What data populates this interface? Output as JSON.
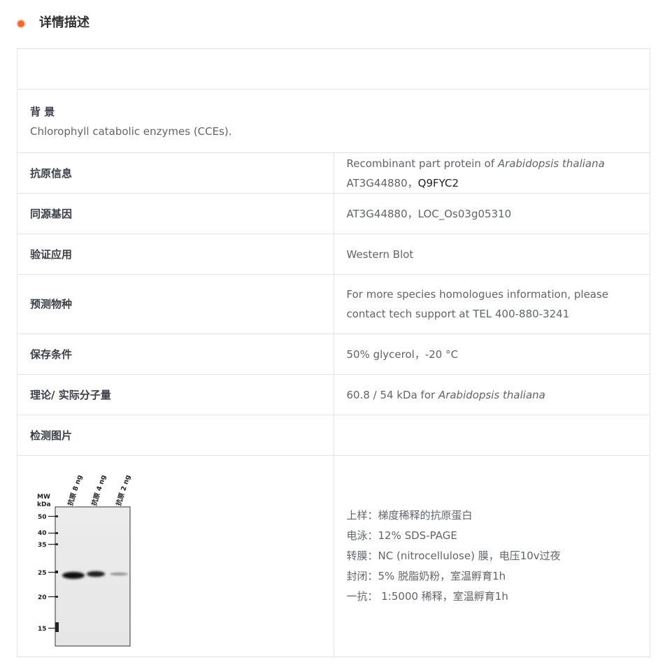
{
  "section": {
    "title": "详情描述"
  },
  "background": {
    "heading": "背 景",
    "text": "Chlorophyll catabolic enzymes (CCEs)."
  },
  "rows": {
    "antigen": {
      "label": "抗原信息",
      "prefix": "Recombinant part protein of ",
      "species": "Arabidopsis thaliana",
      "suffix": " AT3G44880，",
      "uniprot": "Q9FYC2"
    },
    "homolog": {
      "label": "同源基因",
      "value": "AT3G44880，LOC_Os03g05310"
    },
    "application": {
      "label": "验证应用",
      "value": "Western Blot"
    },
    "species": {
      "label": "预测物种",
      "value": "For more species homologues information, please contact tech support at TEL 400-880-3241"
    },
    "storage": {
      "label": "保存条件",
      "value": "50% glycerol，-20 °C"
    },
    "mw": {
      "label": "理论/ 实际分子量",
      "prefix": "60.8 / 54 kDa for ",
      "species": "Arabidopsis thaliana"
    },
    "image": {
      "label": "检测图片",
      "value": ""
    }
  },
  "blot": {
    "mw_label": "MW",
    "kda_label": "kDa",
    "lanes": [
      "抗原 8 ng",
      "抗原 4 ng",
      "抗原 2 ng"
    ],
    "markers": [
      "50",
      "40",
      "35",
      "25",
      "20",
      "15"
    ]
  },
  "notes": [
    "上样：梯度稀释的抗原蛋白",
    "电泳：12% SDS-PAGE",
    "转膜：NC (nitrocellulose) 膜，电压10v过夜",
    "封闭：5% 脱脂奶粉，室温孵育1h",
    "一抗： 1:5000 稀释，室温孵育1h"
  ],
  "colors": {
    "accent": "#f26a32",
    "border": "#e3e3e3",
    "label": "#3c4048",
    "value": "#60646c"
  }
}
